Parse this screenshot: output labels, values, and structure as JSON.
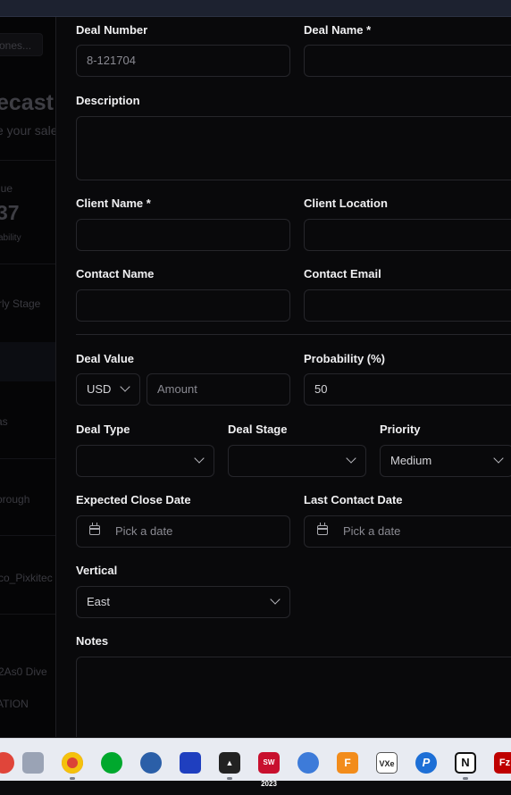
{
  "background_app": {
    "search_placeholder": "ones...",
    "title_fragment": "ecast",
    "subtitle_fragment": "e your sale",
    "stat_label": "lue",
    "stat_value": "37",
    "stat_sub": "ability",
    "stage_filter": "rly Stage",
    "row_texts": [
      "as",
      "orough",
      "co_Pixkitec",
      "2As0 Dive",
      "ATION"
    ]
  },
  "form": {
    "deal_number": {
      "label": "Deal Number",
      "value": "8-121704"
    },
    "deal_name": {
      "label": "Deal Name *",
      "value": ""
    },
    "description": {
      "label": "Description",
      "value": ""
    },
    "client_name": {
      "label": "Client Name *",
      "value": ""
    },
    "client_location": {
      "label": "Client Location",
      "value": ""
    },
    "contact_name": {
      "label": "Contact Name",
      "value": ""
    },
    "contact_email": {
      "label": "Contact Email",
      "value": ""
    },
    "deal_value": {
      "label": "Deal Value",
      "currency": "USD",
      "amount_placeholder": "Amount"
    },
    "probability": {
      "label": "Probability (%)",
      "value": "50"
    },
    "deal_type": {
      "label": "Deal Type",
      "value": ""
    },
    "deal_stage": {
      "label": "Deal Stage",
      "value": ""
    },
    "priority": {
      "label": "Priority",
      "value": "Medium"
    },
    "expected_close_date": {
      "label": "Expected Close Date",
      "placeholder": "Pick a date"
    },
    "last_contact_date": {
      "label": "Last Contact Date",
      "placeholder": "Pick a date"
    },
    "vertical": {
      "label": "Vertical",
      "value": "East"
    },
    "notes": {
      "label": "Notes",
      "value": ""
    }
  },
  "taskbar": {
    "icons": [
      {
        "name": "chrome-icon",
        "color": "#db4437"
      },
      {
        "name": "evernote-icon",
        "color": "#00a82d"
      },
      {
        "name": "browser-icon",
        "color": "#2b5fa8"
      },
      {
        "name": "webex-icon",
        "color": "#1f3fbf"
      },
      {
        "name": "arc-icon",
        "color": "#222222"
      },
      {
        "name": "solidworks-icon",
        "label": "SW 2023",
        "color": "#c8102e"
      },
      {
        "name": "search-tool-icon",
        "color": "#3d7bd9"
      },
      {
        "name": "fusion-icon",
        "label": "F",
        "color": "#f28c1b"
      },
      {
        "name": "vxe-icon",
        "label": "VXe",
        "color": "#ffffff"
      },
      {
        "name": "p-app-icon",
        "label": "P",
        "color": "#1d6fd6"
      },
      {
        "name": "notion-icon",
        "label": "N",
        "color": "#ffffff"
      },
      {
        "name": "filezilla-icon",
        "label": "Fz",
        "color": "#bf0000"
      }
    ]
  }
}
